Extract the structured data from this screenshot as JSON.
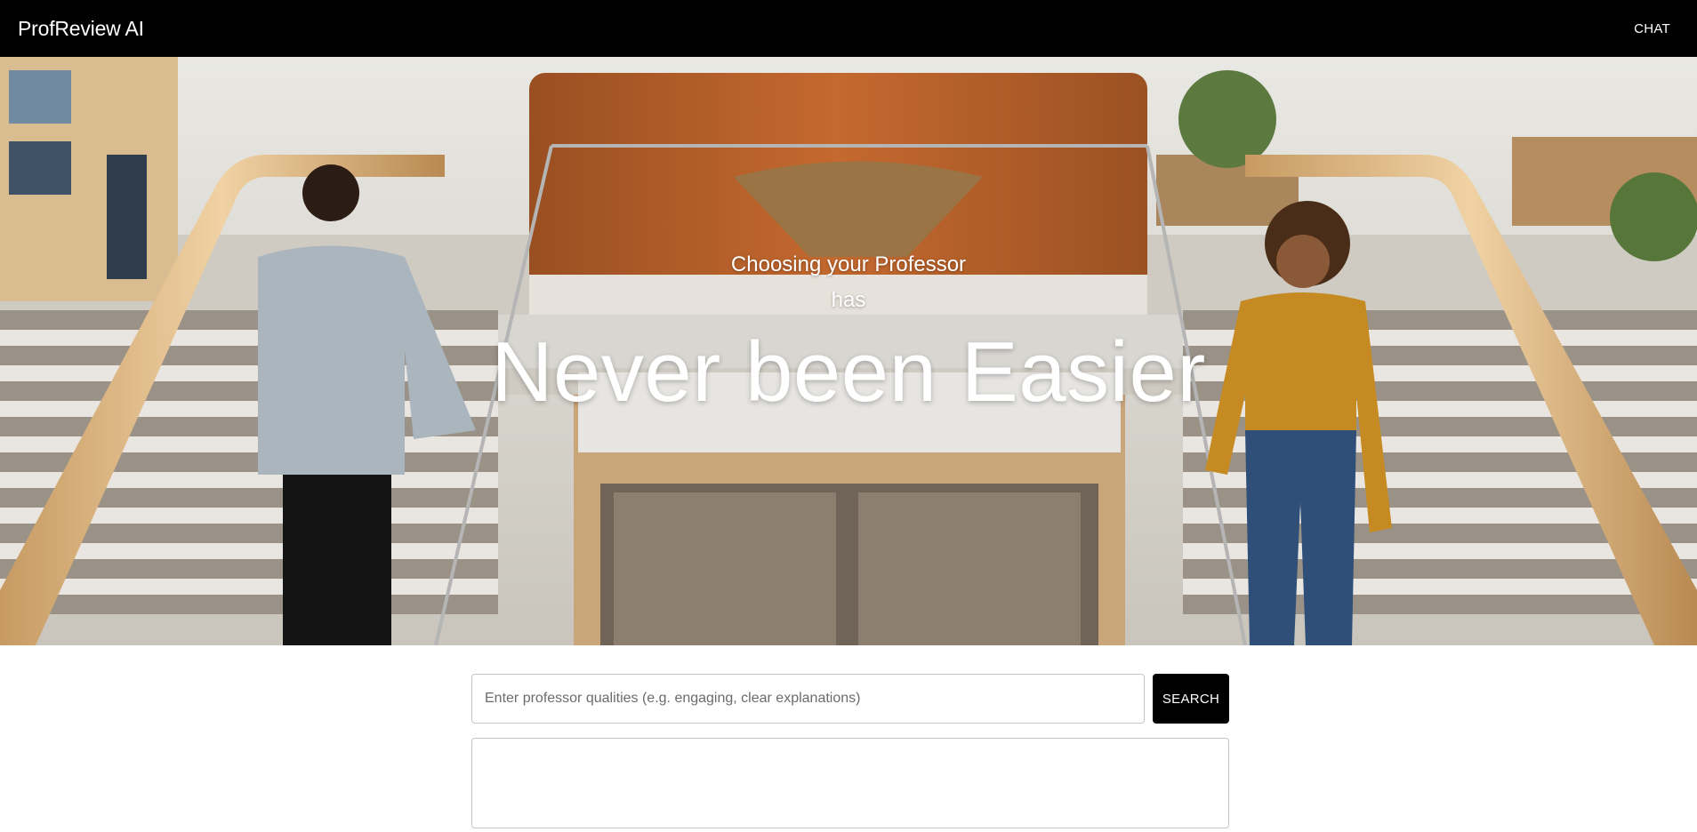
{
  "navbar": {
    "brand": "ProfReview AI",
    "chat_label": "CHAT"
  },
  "hero": {
    "subtitle_line1": "Choosing your Professor",
    "subtitle_line2": "has",
    "headline": "Never been Easier"
  },
  "search": {
    "placeholder": "Enter professor qualities (e.g. engaging, clear explanations)",
    "value": "",
    "button_label": "SEARCH"
  },
  "results": {
    "text": ""
  },
  "colors": {
    "navbar_bg": "#000000",
    "button_bg": "#000000",
    "text_light": "#ffffff",
    "border": "#c4c4c4"
  }
}
